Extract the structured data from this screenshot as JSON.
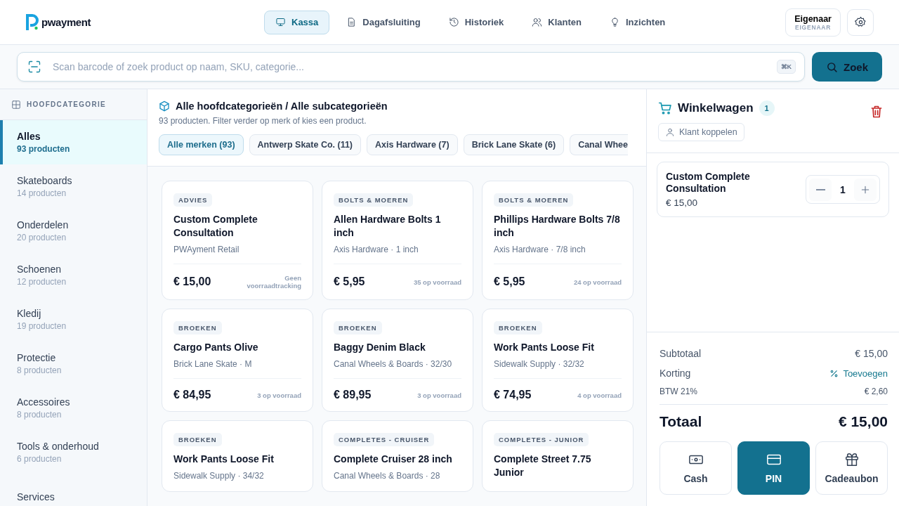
{
  "nav": {
    "logo": "pwayment",
    "tabs": [
      {
        "label": "Kassa",
        "selected": true
      },
      {
        "label": "Dagafsluiting",
        "selected": false
      },
      {
        "label": "Historiek",
        "selected": false
      },
      {
        "label": "Klanten",
        "selected": false
      },
      {
        "label": "Inzichten",
        "selected": false
      }
    ],
    "user": {
      "name": "Eigenaar",
      "role": "EIGENAAR"
    }
  },
  "search": {
    "placeholder": "Scan barcode of zoek product op naam, SKU, categorie...",
    "shortcut": "⌘K",
    "button": "Zoek"
  },
  "sidebar": {
    "heading": "HOOFDCATEGORIE",
    "items": [
      {
        "name": "Alles",
        "count": "93 producten",
        "selected": true
      },
      {
        "name": "Skateboards",
        "count": "14 producten",
        "selected": false
      },
      {
        "name": "Onderdelen",
        "count": "20 producten",
        "selected": false
      },
      {
        "name": "Schoenen",
        "count": "12 producten",
        "selected": false
      },
      {
        "name": "Kledij",
        "count": "19 producten",
        "selected": false
      },
      {
        "name": "Protectie",
        "count": "8 producten",
        "selected": false
      },
      {
        "name": "Accessoires",
        "count": "8 producten",
        "selected": false
      },
      {
        "name": "Tools & onderhoud",
        "count": "6 producten",
        "selected": false
      },
      {
        "name": "Services",
        "selected": false
      }
    ]
  },
  "catalog": {
    "title": "Alle hoofdcategorieën / Alle subcategorieën",
    "subtitle": "93 producten. Filter verder op merk of kies een product.",
    "brands": [
      {
        "label": "Alle merken (93)",
        "selected": true
      },
      {
        "label": "Antwerp Skate Co. (11)",
        "selected": false
      },
      {
        "label": "Axis Hardware (7)",
        "selected": false
      },
      {
        "label": "Brick Lane Skate (6)",
        "selected": false
      },
      {
        "label": "Canal Whee",
        "selected": false
      }
    ],
    "products": [
      {
        "tag": "ADVIES",
        "name": "Custom Complete Consultation",
        "sub": "PWAyment Retail",
        "price": "€ 15,00",
        "stock": "Geen voorraadtracking"
      },
      {
        "tag": "BOLTS & MOEREN",
        "name": "Allen Hardware Bolts 1 inch",
        "sub": "Axis Hardware · 1 inch",
        "price": "€ 5,95",
        "stock": "35 op voorraad"
      },
      {
        "tag": "BOLTS & MOEREN",
        "name": "Phillips Hardware Bolts 7/8 inch",
        "sub": "Axis Hardware · 7/8 inch",
        "price": "€ 5,95",
        "stock": "24 op voorraad"
      },
      {
        "tag": "BROEKEN",
        "name": "Cargo Pants Olive",
        "sub": "Brick Lane Skate · M",
        "price": "€ 84,95",
        "stock": "3 op voorraad"
      },
      {
        "tag": "BROEKEN",
        "name": "Baggy Denim Black",
        "sub": "Canal Wheels & Boards · 32/30",
        "price": "€ 89,95",
        "stock": "3 op voorraad"
      },
      {
        "tag": "BROEKEN",
        "name": "Work Pants Loose Fit",
        "sub": "Sidewalk Supply · 32/32",
        "price": "€ 74,95",
        "stock": "4 op voorraad"
      },
      {
        "tag": "BROEKEN",
        "name": "Work Pants Loose Fit",
        "sub": "Sidewalk Supply · 34/32"
      },
      {
        "tag": "COMPLETES - CRUISER",
        "name": "Complete Cruiser 28 inch",
        "sub": "Canal Wheels & Boards · 28"
      },
      {
        "tag": "COMPLETES - JUNIOR",
        "name": "Complete Street 7.75 Junior"
      }
    ]
  },
  "cart": {
    "title": "Winkelwagen",
    "count": "1",
    "customer_button": "Klant koppelen",
    "items": [
      {
        "name": "Custom Complete Consultation",
        "price": "€ 15,00",
        "quantity": "1"
      }
    ],
    "subtotal_label": "Subtotaal",
    "subtotal": "€ 15,00",
    "discount_label": "Korting",
    "discount_action": "Toevoegen",
    "vat_label": "BTW 21%",
    "vat": "€ 2,60",
    "total_label": "Totaal",
    "total": "€ 15,00",
    "payments": [
      {
        "label": "Cash",
        "selected": false
      },
      {
        "label": "PIN",
        "selected": true
      },
      {
        "label": "Cadeaubon",
        "selected": false
      }
    ]
  }
}
